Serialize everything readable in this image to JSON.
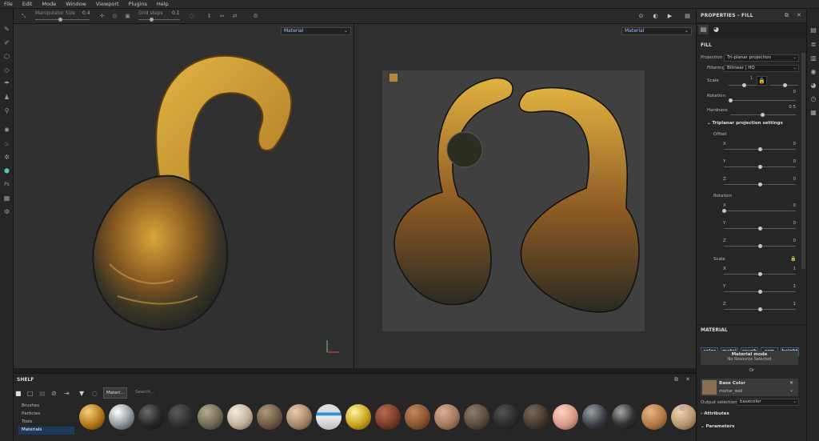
{
  "menu": [
    "File",
    "Edit",
    "Mode",
    "Window",
    "Viewport",
    "Plugins",
    "Help"
  ],
  "toolbar": {
    "manipulator_size_label": "Manipulator Size",
    "manipulator_size_value": "0.4",
    "manipulator_size_level": 0.45,
    "grid_steps_label": "Grid steps",
    "grid_steps_value": "0.1",
    "grid_steps_level": 0.3
  },
  "viewport3d": {
    "mode": "Material"
  },
  "viewport2d": {
    "mode": "Material"
  },
  "properties": {
    "title": "PROPERTIES - FILL",
    "section": "FILL",
    "projection_label": "Projection",
    "projection_value": "Tri-planar projection",
    "filtering_label": "Filtering",
    "filtering_value": "Bilinear | HQ",
    "scale_label": "Scale",
    "scale_value": "1",
    "rotation_label": "Rotation",
    "rotation_value": "0",
    "hardness_label": "Hardness",
    "hardness_value": "0.5",
    "triplanar_title": "Triplanar projection settings",
    "offset_label": "Offset",
    "offset": [
      {
        "axis": "X",
        "value": "0"
      },
      {
        "axis": "Y",
        "value": "0"
      },
      {
        "axis": "Z",
        "value": "0"
      }
    ],
    "rotation_group_label": "Rotation",
    "rotation_axes": [
      {
        "axis": "X",
        "value": "0"
      },
      {
        "axis": "Y",
        "value": "0"
      },
      {
        "axis": "Z",
        "value": "0"
      }
    ],
    "scale_group_label": "Scale",
    "scale_axes": [
      {
        "axis": "X",
        "value": "1"
      },
      {
        "axis": "Y",
        "value": "1"
      },
      {
        "axis": "Z",
        "value": "1"
      }
    ],
    "material_section": "MATERIAL",
    "channels": [
      "color",
      "metal",
      "rough",
      "nrm",
      "height"
    ],
    "material_mode_title": "Material mode",
    "material_mode_sub": "No Resource Selected",
    "or_text": "Or",
    "base_color_label": "Base Color",
    "base_color_name": "mortar_wall",
    "output_selection_label": "Output selection",
    "output_selection_value": "basecolor",
    "attributes_label": "Attributes",
    "parameters_label": "Parameters"
  },
  "shelf": {
    "title": "SHELF",
    "filter_tag": "Materi...",
    "search_placeholder": "Search...",
    "categories": [
      "Brushes",
      "Particles",
      "Tools",
      "Materials"
    ],
    "selected_category": "Materials"
  },
  "colors": {
    "accent": "#3a5e8c",
    "selected_category_bg": "#1e3a5f"
  }
}
